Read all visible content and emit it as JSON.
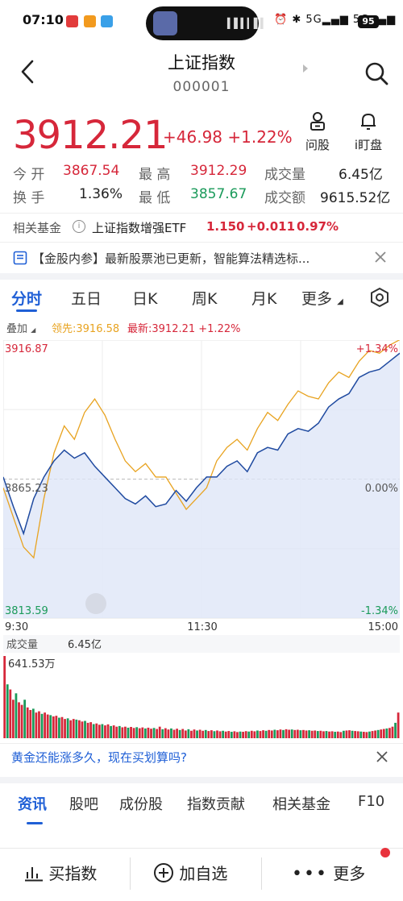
{
  "status_bar": {
    "time": "07:10",
    "battery": "95",
    "signal_label": "5G"
  },
  "header": {
    "title": "上证指数",
    "code": "000001"
  },
  "quote": {
    "price": "3912.21",
    "change": "+46.98 +1.22%",
    "ask_label": "问股",
    "watch_label": "i盯盘",
    "open_label": "今 开",
    "open": "3867.54",
    "high_label": "最 高",
    "high": "3912.29",
    "volume_label": "成交量",
    "volume": "6.45亿",
    "turnover_label": "换 手",
    "turnover": "1.36%",
    "low_label": "最 低",
    "low": "3857.67",
    "amount_label": "成交额",
    "amount": "9615.52亿"
  },
  "related_fund": {
    "label": "相关基金",
    "name": "上证指数增强ETF",
    "price": "1.150",
    "change": "+0.011",
    "pct": "0.97%"
  },
  "news_banner": {
    "text": "【金股内参】最新股票池已更新，智能算法精选标..."
  },
  "chart_tabs": [
    "分时",
    "五日",
    "日K",
    "周K",
    "月K",
    "更多"
  ],
  "chart_info": {
    "overlay_label": "叠加",
    "leader": "领先:3916.58",
    "latest": "最新:3912.21 +1.22%"
  },
  "chart_labels": {
    "y_top": "3916.87",
    "y_mid": "3865.23",
    "y_bottom": "3813.59",
    "pct_top": "+1.34%",
    "pct_mid": "0.00%",
    "pct_bottom": "-1.34%",
    "x_start": "9:30",
    "x_mid": "11:30",
    "x_end": "15:00",
    "vol_label": "成交量",
    "vol_value": "6.45亿",
    "vol_max": "641.53万"
  },
  "colors": {
    "up": "#d6273a",
    "down": "#1a9a5a",
    "accent": "#1f5fd6",
    "leader_line": "#e8a320",
    "price_line": "#1f4aa0"
  },
  "chart_data": {
    "type": "line",
    "ylim": [
      3813.59,
      3916.87
    ],
    "x_range": [
      "9:30",
      "15:00"
    ],
    "series": [
      {
        "name": "领先",
        "values": [
          3862,
          3851,
          3840,
          3836,
          3858,
          3875,
          3885,
          3880,
          3890,
          3895,
          3889,
          3880,
          3872,
          3868,
          3871,
          3866,
          3866,
          3860,
          3854,
          3858,
          3862,
          3872,
          3877,
          3880,
          3876,
          3884,
          3890,
          3887,
          3893,
          3898,
          3896,
          3895,
          3901,
          3905,
          3903,
          3909,
          3913,
          3912,
          3915,
          3917
        ]
      },
      {
        "name": "最新",
        "values": [
          3866,
          3855,
          3845,
          3858,
          3866,
          3872,
          3876,
          3873,
          3875,
          3870,
          3866,
          3862,
          3858,
          3856,
          3859,
          3855,
          3856,
          3861,
          3857,
          3862,
          3866,
          3866,
          3870,
          3872,
          3868,
          3875,
          3877,
          3876,
          3882,
          3884,
          3883,
          3886,
          3892,
          3895,
          3897,
          3903,
          3905,
          3906,
          3909,
          3912
        ]
      }
    ],
    "volume_max_label": "641.53万",
    "volume": [
      641,
      420,
      380,
      300,
      350,
      280,
      260,
      300,
      240,
      220,
      230,
      200,
      210,
      190,
      200,
      185,
      180,
      170,
      175,
      160,
      165,
      150,
      155,
      140,
      150,
      145,
      140,
      130,
      135,
      120,
      125,
      110,
      115,
      105,
      110,
      100,
      108,
      95,
      100,
      90,
      95,
      85,
      90,
      82,
      88,
      80,
      86,
      78,
      84,
      76,
      82,
      74,
      80,
      72,
      90,
      70,
      78,
      68,
      76,
      66,
      74,
      64,
      72,
      60,
      70,
      58,
      68,
      60,
      66,
      58,
      64,
      56,
      62,
      55,
      60,
      54,
      58,
      52,
      56,
      50,
      54,
      48,
      52,
      50,
      55,
      52,
      58,
      54,
      60,
      56,
      62,
      58,
      64,
      60,
      66,
      62,
      68,
      64,
      70,
      66,
      68,
      64,
      66,
      62,
      64,
      60,
      62,
      58,
      60,
      56,
      58,
      54,
      56,
      52,
      54,
      50,
      52,
      48,
      58,
      60,
      62,
      58,
      56,
      54,
      52,
      50,
      48,
      52,
      56,
      60,
      64,
      68,
      72,
      76,
      80,
      90,
      120,
      200
    ]
  },
  "ad_banner": {
    "text": "黄金还能涨多久，现在买划算吗?"
  },
  "sub_tabs": [
    "资讯",
    "股吧",
    "成份股",
    "指数贡献",
    "相关基金",
    "F10"
  ],
  "bottom_bar": {
    "buy": "买指数",
    "add": "加自选",
    "more": "更多"
  }
}
